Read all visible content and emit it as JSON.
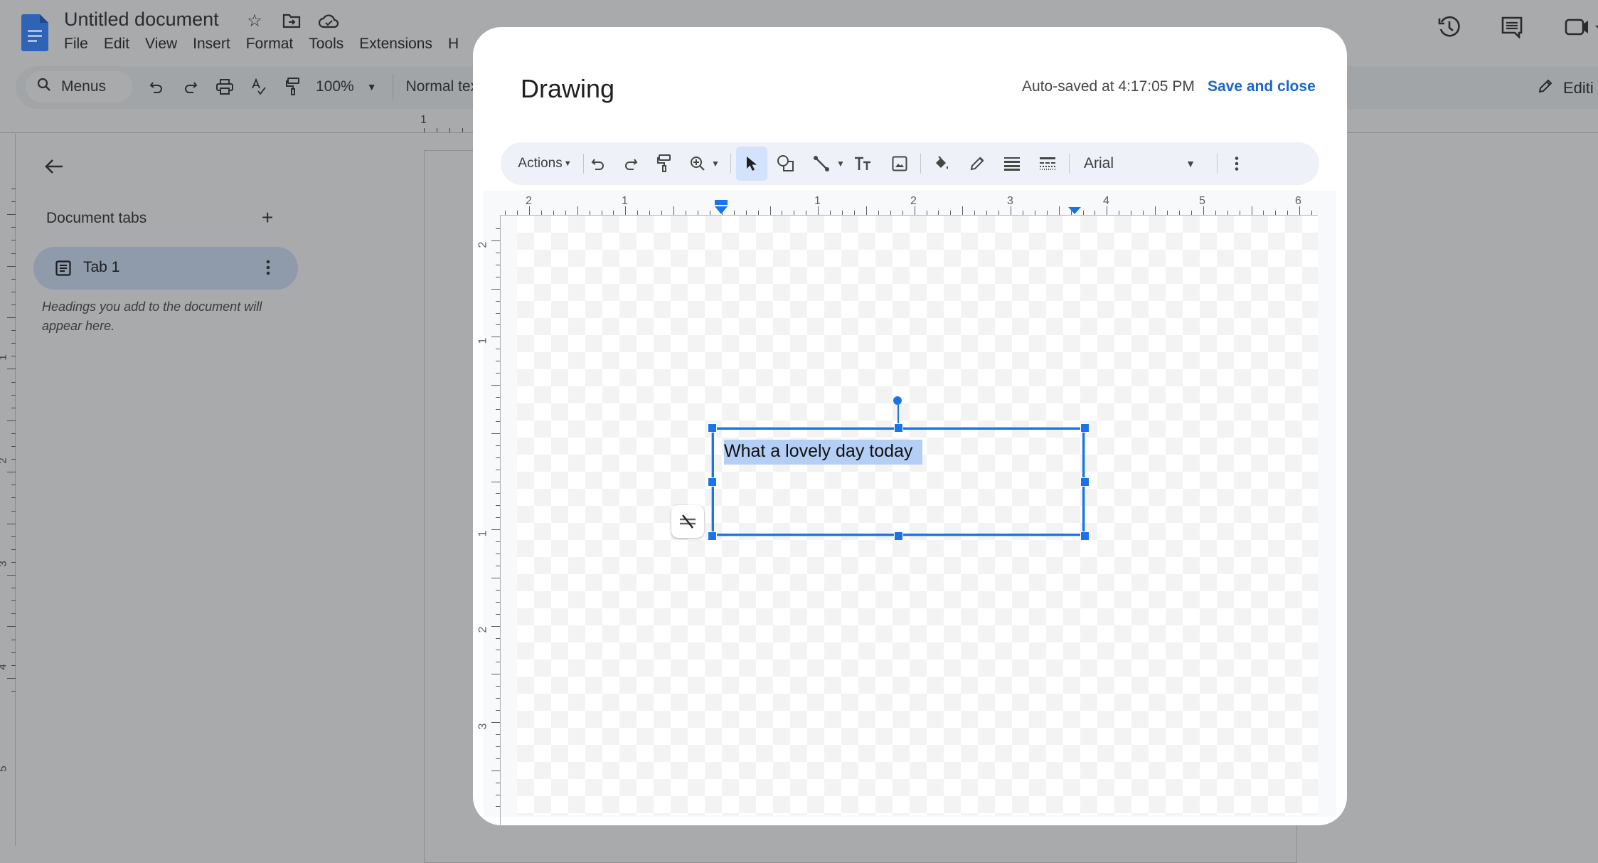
{
  "docs": {
    "title": "Untitled document",
    "menu": [
      "File",
      "Edit",
      "View",
      "Insert",
      "Format",
      "Tools",
      "Extensions",
      "H"
    ],
    "toolbar": {
      "search_label": "Menus",
      "zoom": "100%",
      "style": "Normal tex",
      "editing_label": "Editi"
    },
    "ruler_top_numbers": [
      "1"
    ],
    "ruler_left_numbers": [
      "1",
      "2",
      "3",
      "4",
      "5"
    ],
    "sidebar": {
      "section_title": "Document tabs",
      "tabs": [
        {
          "label": "Tab 1"
        }
      ],
      "hint": "Headings you add to the document will appear here."
    }
  },
  "drawing": {
    "title": "Drawing",
    "autosave_status": "Auto-saved at 4:17:05 PM",
    "save_close_label": "Save and close",
    "toolbar": {
      "actions_label": "Actions",
      "font": "Arial",
      "active_tool": "select"
    },
    "ruler_h_numbers": [
      "2",
      "1",
      "1",
      "2",
      "3",
      "4",
      "5",
      "6"
    ],
    "ruler_v_numbers": [
      "2",
      "1",
      "1",
      "2",
      "3"
    ],
    "textbox_text": "What a lovely day today",
    "accent_color": "#1a73e8",
    "link_color": "#1a66d2"
  }
}
